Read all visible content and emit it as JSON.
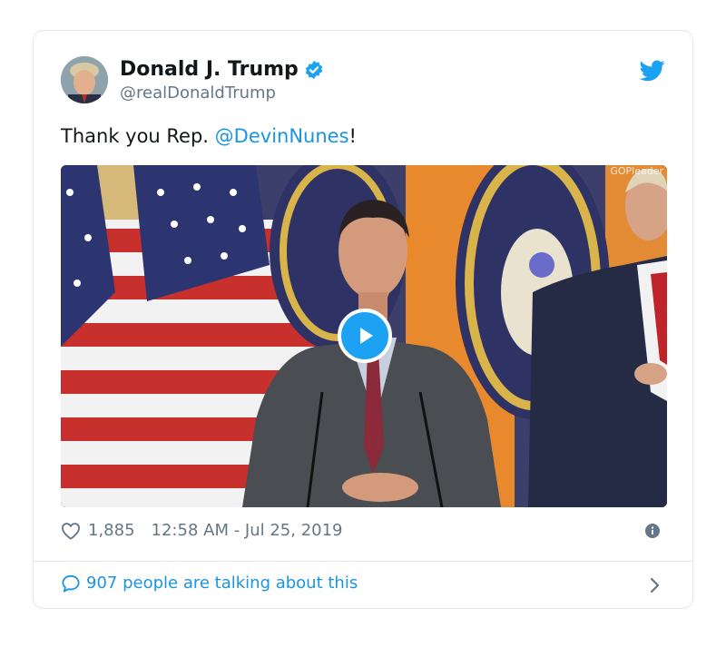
{
  "tweet": {
    "author_name": "Donald J. Trump",
    "author_handle": "@realDonaldTrump",
    "text_prefix": "Thank you Rep. ",
    "mention": "@DevinNunes",
    "text_suffix": "!",
    "media_watermark": "GOPleader",
    "likes": "1,885",
    "timestamp": "12:58 AM - Jul 25, 2019",
    "talking_about": "907 people are talking about this"
  },
  "icons": {
    "verified": "verified-badge-icon",
    "brand": "twitter-bird-icon",
    "play": "play-icon",
    "like": "heart-icon",
    "info": "info-icon",
    "reply": "speech-bubble-icon",
    "more": "chevron-right-icon"
  },
  "colors": {
    "accent": "#1da1f2",
    "link": "#1b95e0",
    "muted": "#657786",
    "border": "#e1e8ed"
  }
}
